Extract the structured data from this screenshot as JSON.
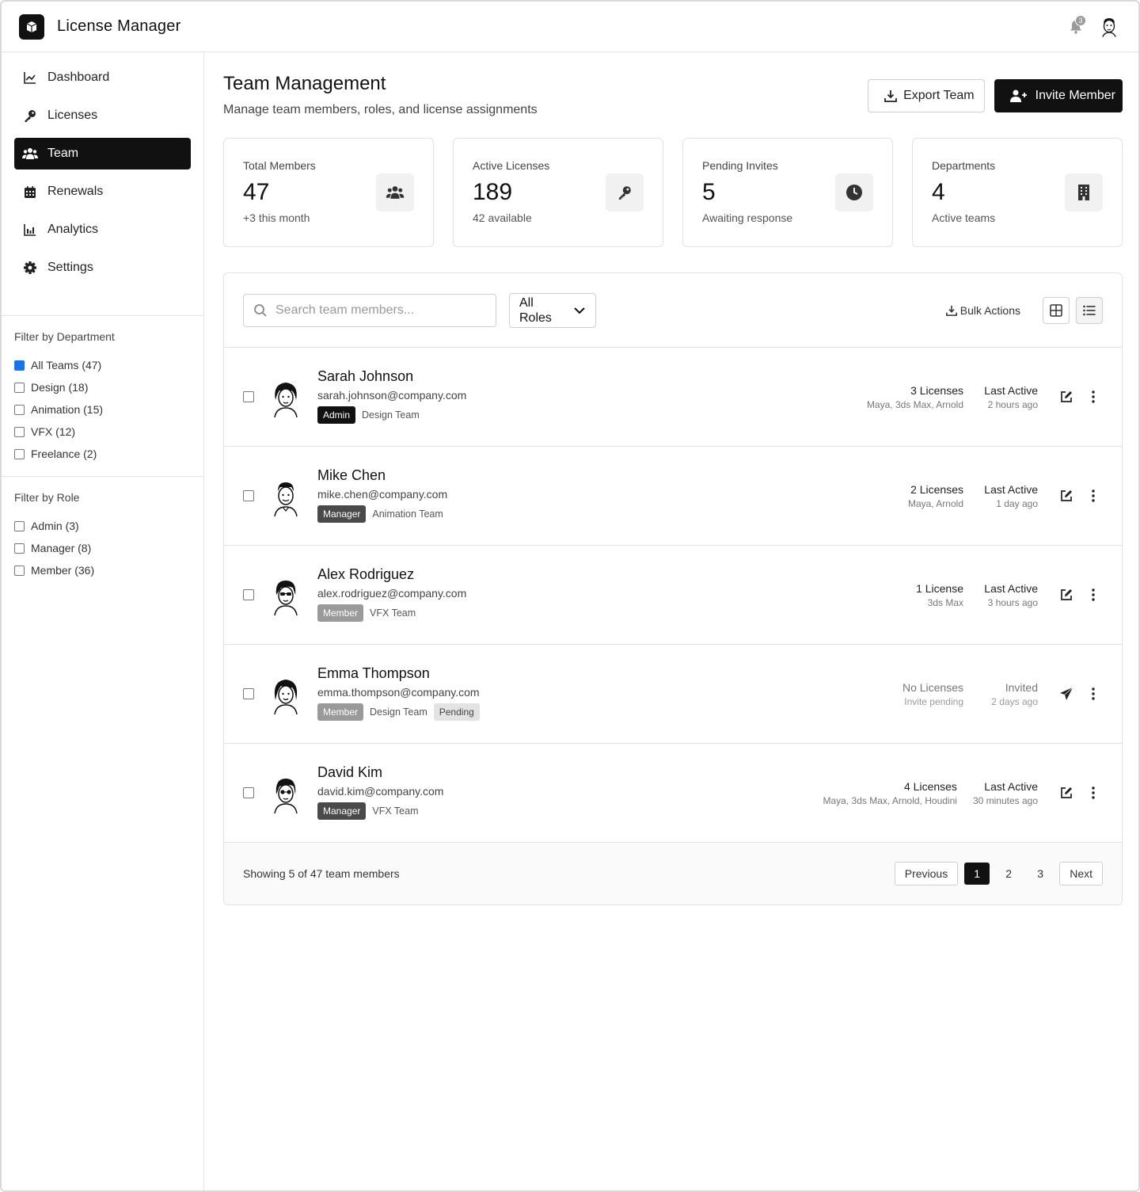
{
  "app": {
    "title": "License Manager",
    "notification_count": "3"
  },
  "sidebar": {
    "nav": [
      {
        "label": "Dashboard",
        "icon": "chart-line-icon"
      },
      {
        "label": "Licenses",
        "icon": "key-icon"
      },
      {
        "label": "Team",
        "icon": "users-icon",
        "active": true
      },
      {
        "label": "Renewals",
        "icon": "calendar-icon"
      },
      {
        "label": "Analytics",
        "icon": "bar-chart-icon"
      },
      {
        "label": "Settings",
        "icon": "gear-icon"
      }
    ],
    "dept_filter": {
      "title": "Filter by Department",
      "options": [
        "All Teams (47)",
        "Design (18)",
        "Animation (15)",
        "VFX (12)",
        "Freelance (2)"
      ]
    },
    "role_filter": {
      "title": "Filter by Role",
      "options": [
        "Admin (3)",
        "Manager (8)",
        "Member (36)"
      ]
    }
  },
  "page": {
    "title": "Team Management",
    "subtitle": "Manage team members, roles, and license assignments",
    "export_label": "Export Team",
    "invite_label": "Invite Member"
  },
  "stats": [
    {
      "label": "Total Members",
      "value": "47",
      "sub": "+3 this month",
      "icon": "users-icon"
    },
    {
      "label": "Active Licenses",
      "value": "189",
      "sub": "42 available",
      "icon": "key-icon"
    },
    {
      "label": "Pending Invites",
      "value": "5",
      "sub": "Awaiting response",
      "icon": "clock-icon"
    },
    {
      "label": "Departments",
      "value": "4",
      "sub": "Active teams",
      "icon": "building-icon"
    }
  ],
  "toolbar": {
    "search_placeholder": "Search team members...",
    "role_select": "All Roles",
    "bulk_label": "Bulk Actions"
  },
  "members": [
    {
      "name": "Sarah Johnson",
      "email": "sarah.johnson@company.com",
      "role": "Admin",
      "dept": "Design Team",
      "licenses": "3 Licenses",
      "apps": "Maya, 3ds Max, Arnold",
      "status_title": "Last Active",
      "status_time": "2 hours ago"
    },
    {
      "name": "Mike Chen",
      "email": "mike.chen@company.com",
      "role": "Manager",
      "dept": "Animation Team",
      "licenses": "2 Licenses",
      "apps": "Maya, Arnold",
      "status_title": "Last Active",
      "status_time": "1 day ago"
    },
    {
      "name": "Alex Rodriguez",
      "email": "alex.rodriguez@company.com",
      "role": "Member",
      "dept": "VFX Team",
      "licenses": "1 License",
      "apps": "3ds Max",
      "status_title": "Last Active",
      "status_time": "3 hours ago"
    },
    {
      "name": "Emma Thompson",
      "email": "emma.thompson@company.com",
      "role": "Member",
      "dept": "Design Team",
      "extra_tag": "Pending",
      "licenses": "No Licenses",
      "apps": "Invite pending",
      "status_title": "Invited",
      "status_time": "2 days ago"
    },
    {
      "name": "David Kim",
      "email": "david.kim@company.com",
      "role": "Manager",
      "dept": "VFX Team",
      "licenses": "4 Licenses",
      "apps": "Maya, 3ds Max, Arnold, Houdini",
      "status_title": "Last Active",
      "status_time": "30 minutes ago"
    }
  ],
  "pagination": {
    "summary": "Showing 5 of 47 team members",
    "previous": "Previous",
    "next": "Next",
    "pages": [
      "1",
      "2",
      "3"
    ],
    "current": "1"
  }
}
